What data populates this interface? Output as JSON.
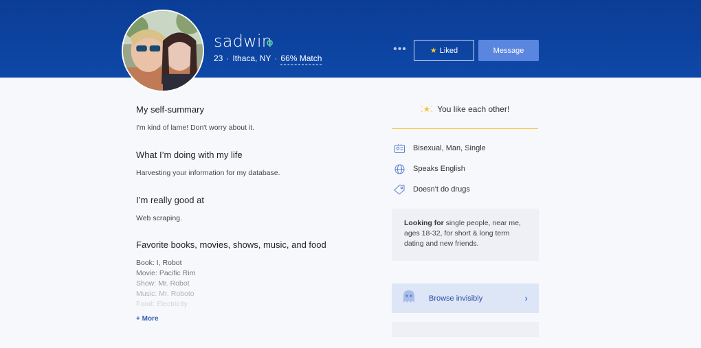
{
  "profile": {
    "username": "sadwin",
    "age": "23",
    "location": "Ithaca, NY",
    "match": "66% Match",
    "online_color": "#3fcf9b"
  },
  "actions": {
    "more": "•••",
    "liked_label": "Liked",
    "message_label": "Message"
  },
  "essays": [
    {
      "title": "My self-summary",
      "text": "I'm kind of lame! Don't worry about it."
    },
    {
      "title": "What I’m doing with my life",
      "text": "Harvesting your information for my database."
    },
    {
      "title": "I’m really good at",
      "text": "Web scraping."
    },
    {
      "title": "Favorite books, movies, shows, music, and food",
      "lines": [
        "Book: I, Robot",
        "Movie: Pacific Rim",
        "Show: Mr. Robot",
        "Music: Mr. Roboto",
        "Food: Electricity"
      ]
    }
  ],
  "more_link": "+ More",
  "mutual": {
    "icon": "stars-icon",
    "text": "You like each other!"
  },
  "details": [
    {
      "icon": "id-card-icon",
      "text": "Bisexual, Man, Single"
    },
    {
      "icon": "globe-icon",
      "text": "Speaks English"
    },
    {
      "icon": "tag-icon",
      "text": "Doesn't do drugs"
    }
  ],
  "looking_for": {
    "bold": "Looking for",
    "text": " single people, near me, ages 18-32, for short & long term dating and new friends."
  },
  "browse": {
    "icon": "ghost-icon",
    "label": "Browse invisibly",
    "chevron": "›"
  },
  "colors": {
    "header": "#0e48a8",
    "accent": "#5a86e0",
    "gold": "#f5c33b"
  }
}
